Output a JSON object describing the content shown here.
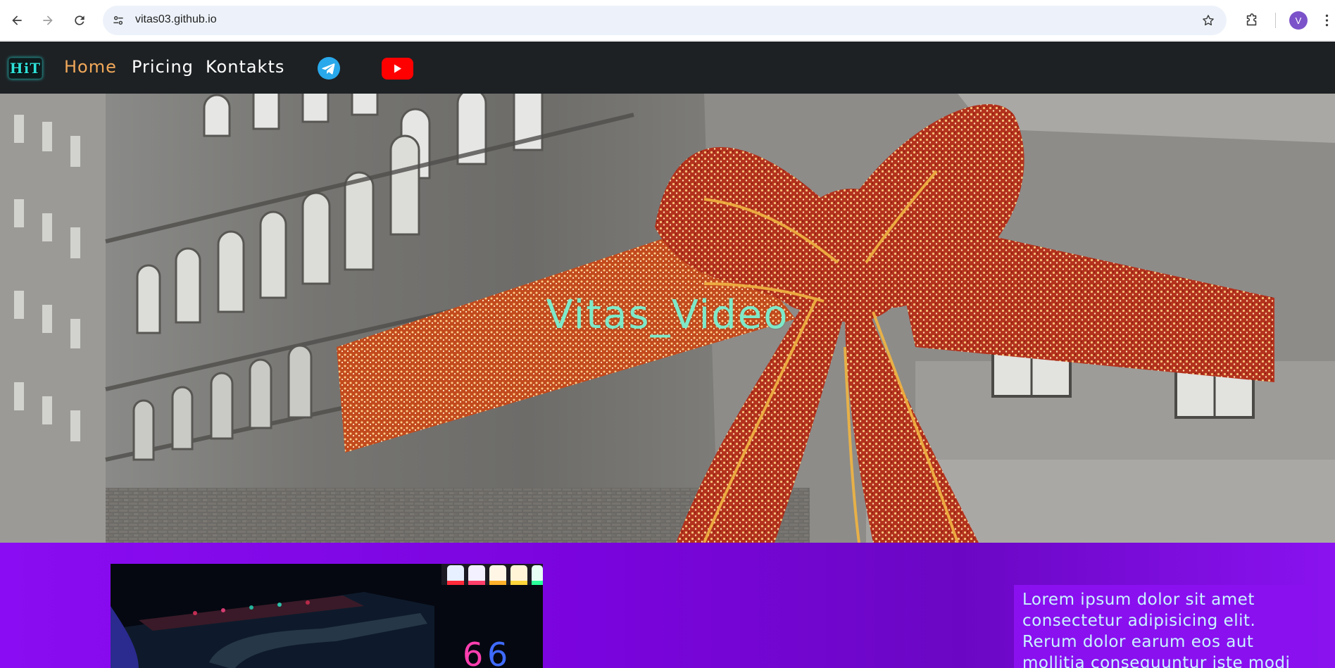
{
  "browser": {
    "url": "vitas03.github.io",
    "avatar_letter": "V"
  },
  "site_nav": {
    "logo_text": "HiT",
    "links": [
      {
        "label": "Home",
        "active": true
      },
      {
        "label": "Pricing",
        "active": false
      },
      {
        "label": "Kontakts",
        "active": false
      }
    ],
    "social": [
      "telegram-icon",
      "youtube-icon"
    ],
    "accent_color": "#f2a95a",
    "bar_color": "#1d2124"
  },
  "hero": {
    "title": "Vitas_Video",
    "title_color": "#7ee9c9"
  },
  "content": {
    "lorem": "Lorem ipsum dolor sit amet consectetur adipisicing elit. Rerum dolor earum eos aut mollitia consequuntur iste modi",
    "background_color": "#8a0cf2",
    "text_color": "#c9f5ff"
  }
}
